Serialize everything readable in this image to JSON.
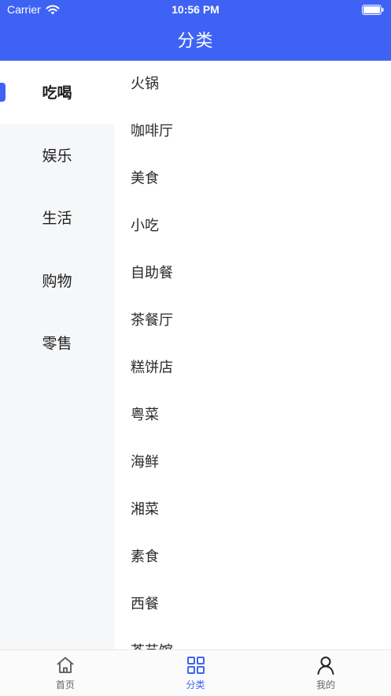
{
  "status_bar": {
    "carrier": "Carrier",
    "time": "10:56 PM"
  },
  "nav": {
    "title": "分类"
  },
  "colors": {
    "accent": "#3e63f4",
    "sidebar_bg": "#f6f7f9"
  },
  "sidebar": {
    "items": [
      {
        "label": "吃喝",
        "active": true
      },
      {
        "label": "娱乐",
        "active": false
      },
      {
        "label": "生活",
        "active": false
      },
      {
        "label": "购物",
        "active": false
      },
      {
        "label": "零售",
        "active": false
      }
    ]
  },
  "sub_list": {
    "items": [
      "火锅",
      "咖啡厅",
      "美食",
      "小吃",
      "自助餐",
      "茶餐厅",
      "糕饼店",
      "粤菜",
      "海鲜",
      "湘菜",
      "素食",
      "西餐",
      "茶艺馆"
    ]
  },
  "tabbar": {
    "tabs": [
      {
        "label": "首页",
        "icon": "home-icon",
        "active": false
      },
      {
        "label": "分类",
        "icon": "grid-icon",
        "active": true
      },
      {
        "label": "我的",
        "icon": "user-icon",
        "active": false
      }
    ]
  }
}
